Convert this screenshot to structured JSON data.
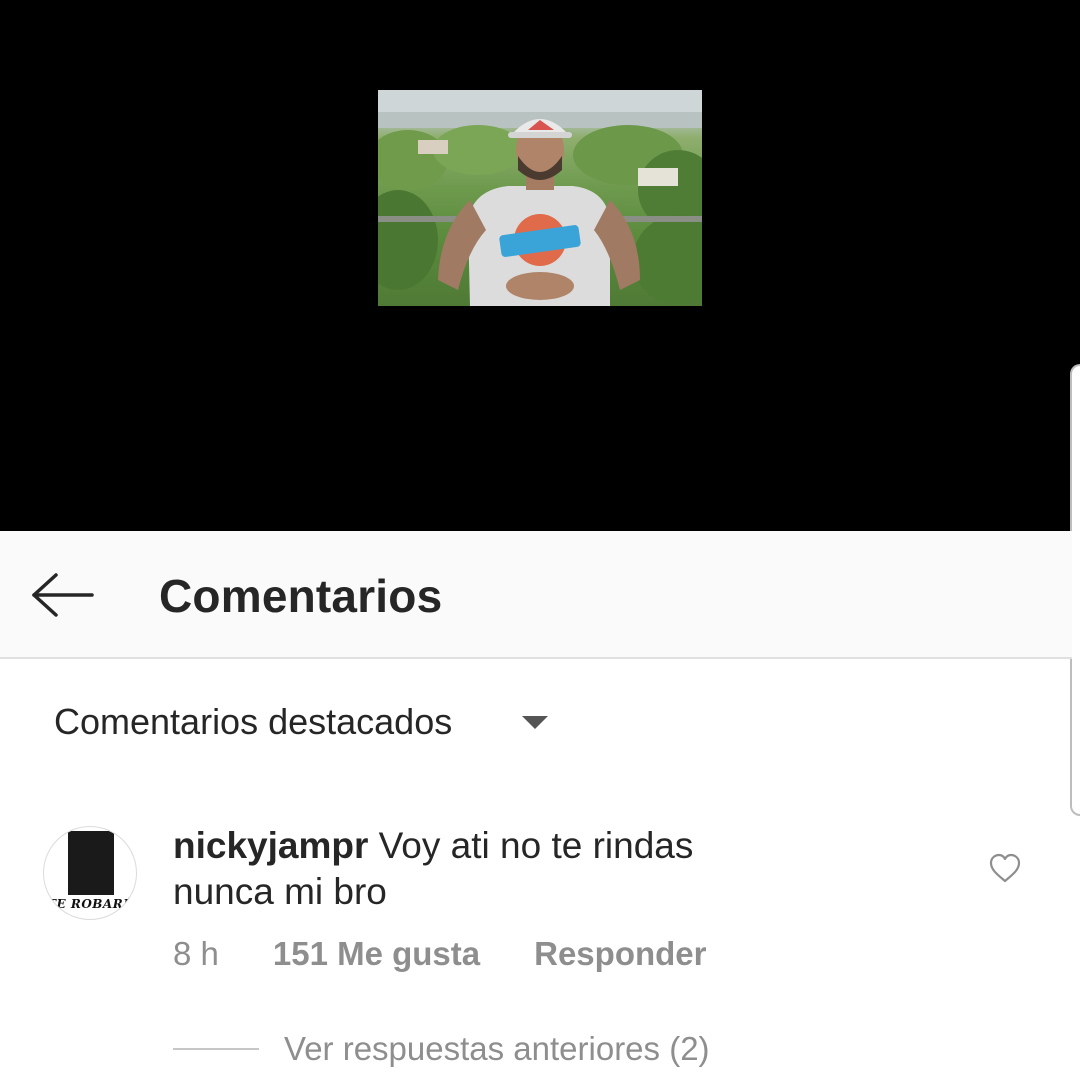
{
  "header": {
    "title": "Comentarios",
    "back_icon": "arrow-left-icon"
  },
  "sort": {
    "label": "Comentarios destacados",
    "caret_icon": "caret-down-icon"
  },
  "comment": {
    "username": "nickyjampr",
    "text": "Voy ati no te rindas nunca mi bro",
    "time": "8 h",
    "likes": "151 Me gusta",
    "reply_label": "Responder",
    "avatar_text": "TE ROBARÉ",
    "like_icon": "heart-outline-icon"
  },
  "replies": {
    "label": "Ver respuestas anteriores (2)"
  },
  "colors": {
    "video_bg": "#000000",
    "header_bg": "#fafafa",
    "text_primary": "#262626",
    "text_secondary": "#8e8e8e"
  }
}
